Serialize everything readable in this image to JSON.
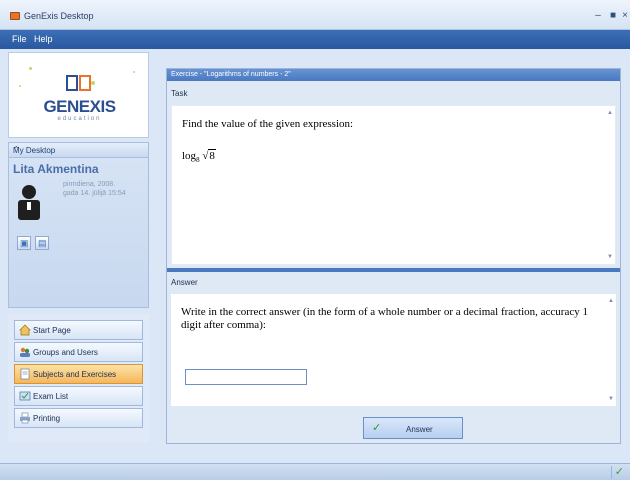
{
  "window": {
    "title": "GenExis Desktop"
  },
  "menu": {
    "file": "File",
    "help": "Help"
  },
  "logo": {
    "brand": "GENEXIS",
    "tagline": "education"
  },
  "desktop": {
    "header": "My Desktop",
    "user_name": "Lita Akmentina",
    "date_line1": "pirmdiena, 2008.",
    "date_line2": "gada 14. jūlijā 15:54"
  },
  "nav": [
    {
      "label": "Start Page",
      "icon": "home-icon"
    },
    {
      "label": "Groups and Users",
      "icon": "users-icon"
    },
    {
      "label": "Subjects and Exercises",
      "icon": "document-icon",
      "active": true
    },
    {
      "label": "Exam List",
      "icon": "exam-icon"
    },
    {
      "label": "Printing",
      "icon": "printer-icon"
    }
  ],
  "exercise": {
    "title": "Exercise - \"Logarithms of numbers - 2\"",
    "task_label": "Task",
    "task_text": "Find the value of the given expression:",
    "formula_log": "log",
    "formula_base": "8",
    "formula_radicand": "8",
    "answer_label": "Answer",
    "answer_instruction": "Write in the correct answer (in the form of a whole number or a decimal fraction, accuracy 1 digit after comma):",
    "answer_value": "",
    "answer_button": "Answer"
  },
  "colors": {
    "accent": "#4a79c0",
    "active_nav": "#f5b65c",
    "status_ok": "#3aa030"
  }
}
